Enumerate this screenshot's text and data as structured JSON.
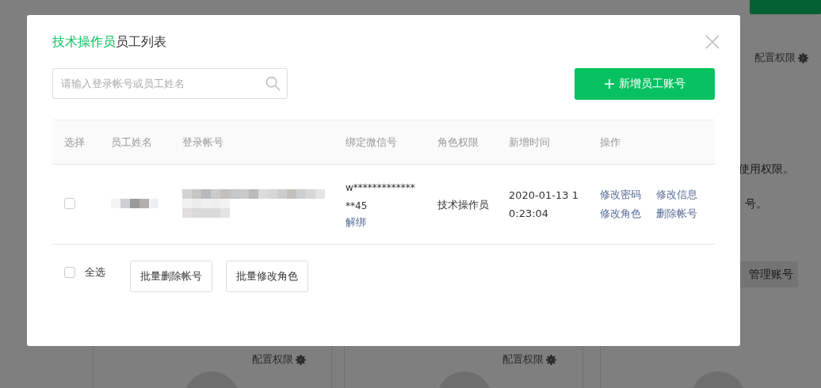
{
  "background": {
    "config_labels": [
      "配置权限",
      "配置权限",
      "配置权限"
    ],
    "text_lines": [
      "使用权限。",
      "号。"
    ],
    "manage_button": "管理账号"
  },
  "dialog": {
    "title_role": "技术操作员",
    "title_rest": "员工列表",
    "search": {
      "placeholder": "请输入登录帐号或员工姓名"
    },
    "add_button": "新增员工账号",
    "table": {
      "columns": [
        "选择",
        "员工姓名",
        "登录帐号",
        "绑定微信号",
        "角色权限",
        "新增时间",
        "操作"
      ],
      "rows": [
        {
          "checked": false,
          "wechat": "w*************\n**45",
          "unbind": "解绑",
          "role": "技术操作员",
          "time": "2020-01-13 10:23:04",
          "actions": [
            "修改密码",
            "修改信息",
            "修改角色",
            "删除帐号"
          ]
        }
      ]
    },
    "select_all": {
      "label": "全选",
      "checked": false
    },
    "footer_buttons": [
      "批量删除帐号",
      "批量修改角色"
    ]
  }
}
